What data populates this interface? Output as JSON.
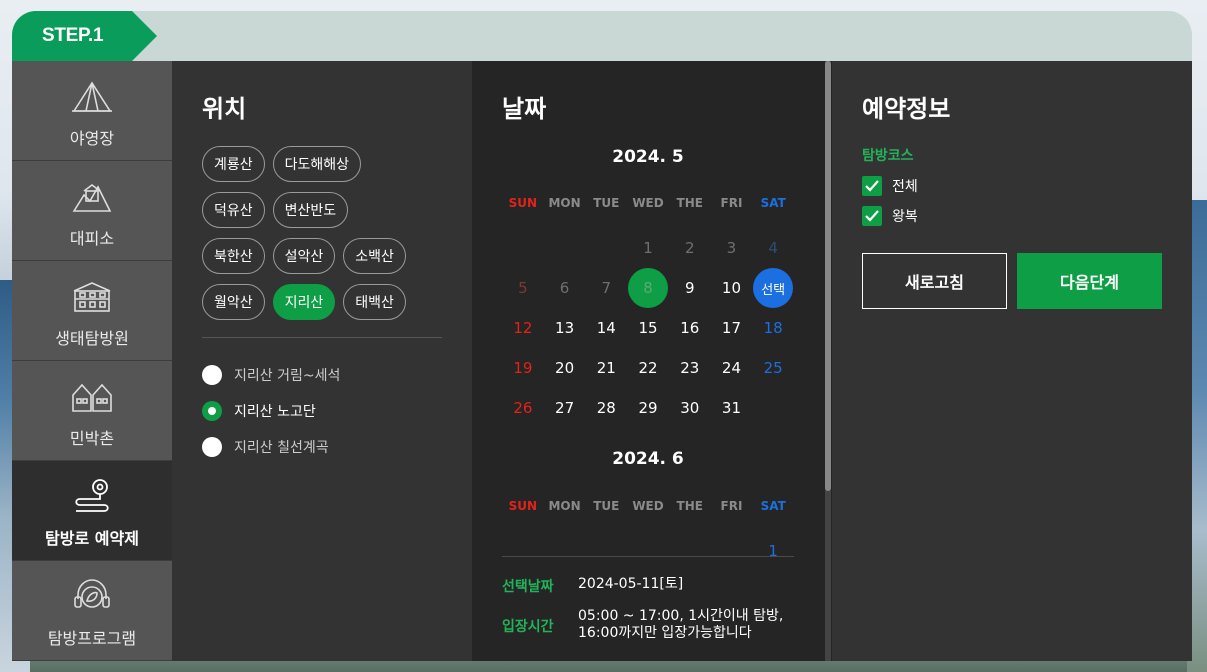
{
  "step": {
    "label": "STEP.1"
  },
  "sidebar": {
    "items": [
      {
        "label": "야영장",
        "icon": "tent-icon"
      },
      {
        "label": "대피소",
        "icon": "shelter-icon"
      },
      {
        "label": "생태탐방원",
        "icon": "eco-center-icon"
      },
      {
        "label": "민박촌",
        "icon": "houses-icon"
      },
      {
        "label": "탐방로 예약제",
        "icon": "trail-pin-icon",
        "active": true
      },
      {
        "label": "탐방프로그램",
        "icon": "headset-leaf-icon"
      }
    ]
  },
  "location": {
    "title": "위치",
    "chips": [
      [
        "계룡산",
        "다도해해상"
      ],
      [
        "덕유산",
        "변산반도"
      ],
      [
        "북한산",
        "설악산",
        "소백산"
      ],
      [
        "월악산",
        "지리산",
        "태백산"
      ]
    ],
    "selected_chip": "지리산",
    "trails": [
      "지리산 거림~세석",
      "지리산 노고단",
      "지리산 칠선계곡"
    ],
    "selected_trail": "지리산 노고단"
  },
  "date": {
    "title": "날짜",
    "weekdays": [
      "SUN",
      "MON",
      "TUE",
      "WED",
      "THE",
      "FRI",
      "SAT"
    ],
    "months": [
      {
        "title": "2024. 5",
        "weeks": [
          [
            "",
            "",
            "",
            "1",
            "2",
            "3",
            "4"
          ],
          [
            "5",
            "6",
            "7",
            "8",
            "9",
            "10",
            "선택"
          ],
          [
            "12",
            "13",
            "14",
            "15",
            "16",
            "17",
            "18"
          ],
          [
            "19",
            "20",
            "21",
            "22",
            "23",
            "24",
            "25"
          ],
          [
            "26",
            "27",
            "28",
            "29",
            "30",
            "31",
            ""
          ]
        ],
        "past_through_day": 7,
        "today": "8",
        "selected_label": "선택"
      },
      {
        "title": "2024. 6",
        "weeks": [
          [
            "",
            "",
            "",
            "",
            "",
            "",
            "1"
          ]
        ]
      }
    ],
    "selected_date_label": "선택날짜",
    "selected_date_value": "2024-05-11[토]",
    "entry_time_label": "입장시간",
    "entry_time_value": "05:00 ~ 17:00, 1시간이내 탐방, 16:00까지만 입장가능합니다"
  },
  "reservation": {
    "title": "예약정보",
    "course_label": "탐방코스",
    "options": [
      "전체",
      "왕복"
    ],
    "refresh_label": "새로고침",
    "next_label": "다음단계"
  },
  "colors": {
    "accent_green": "#0e9e45",
    "sunday_red": "#e2231a",
    "saturday_blue": "#1b6fe0"
  }
}
